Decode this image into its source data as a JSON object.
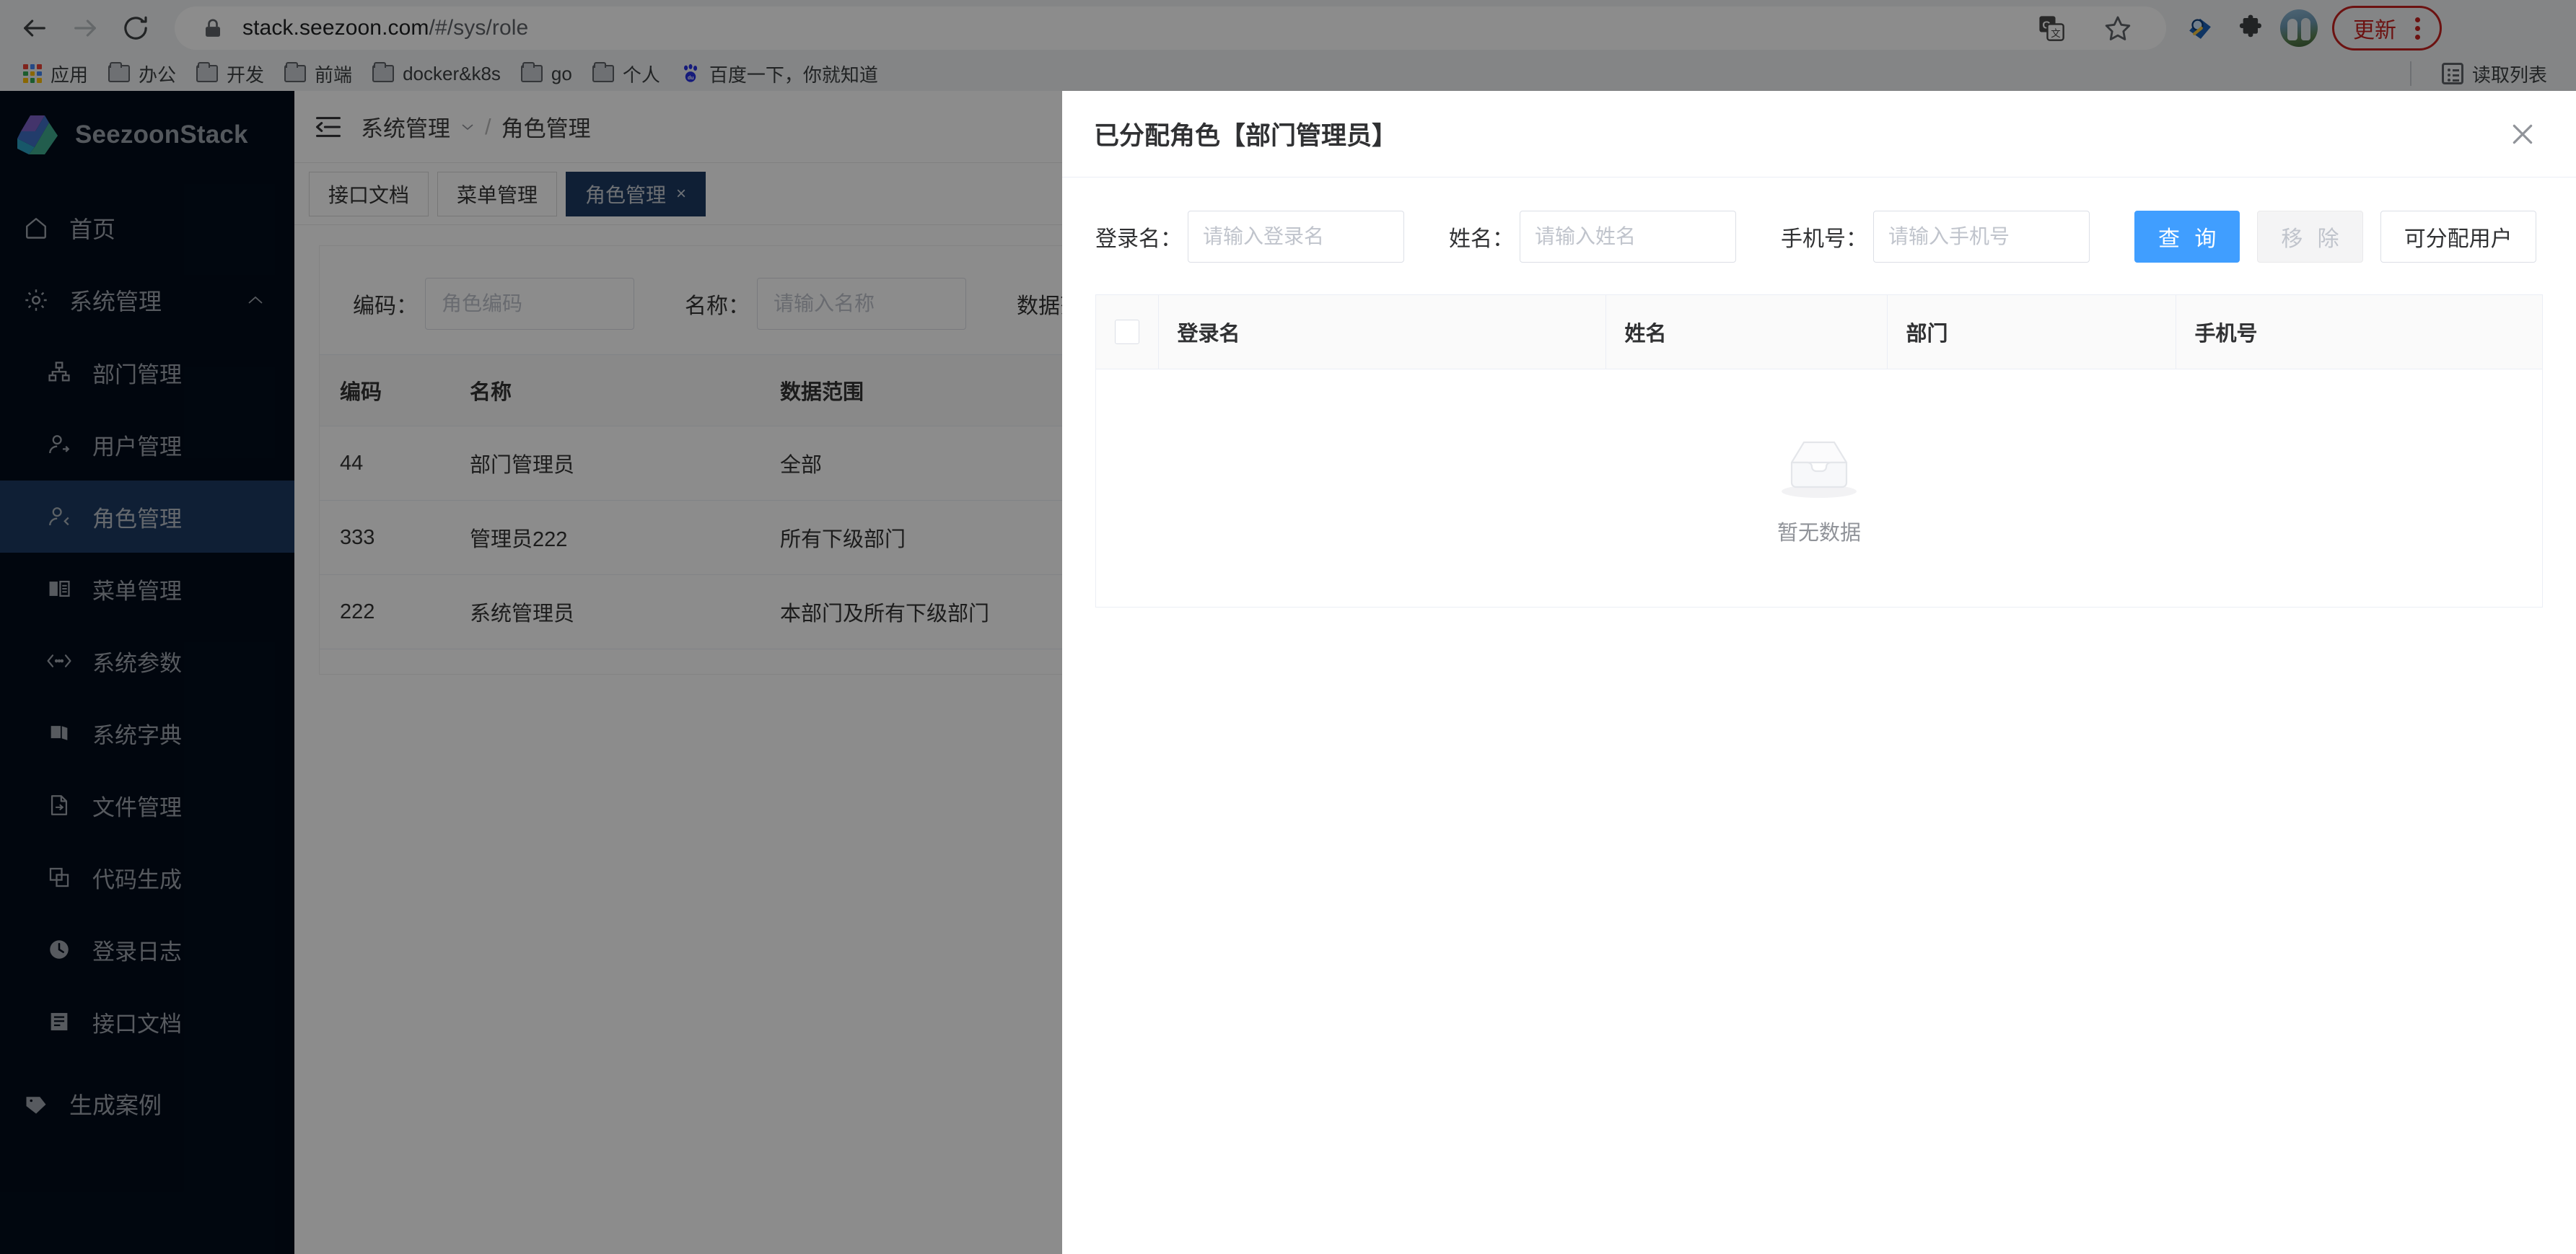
{
  "browser": {
    "url_main": "stack.seezoon.com",
    "url_path": "/#/sys/role",
    "nav": {
      "back": "back-arrow",
      "forward": "forward-arrow",
      "reload": "reload"
    },
    "actions": {
      "translate": "translate-icon",
      "bookmark_star": "star-icon",
      "extension_blue": "extension-icon",
      "extension_puzzle": "puzzle-icon",
      "profile": "avatar",
      "update_label": "更新",
      "menu": "kebab-menu"
    },
    "bookmarks": [
      {
        "label": "应用",
        "icon": "apps-grid-icon"
      },
      {
        "label": "办公",
        "icon": "folder-icon"
      },
      {
        "label": "开发",
        "icon": "folder-icon"
      },
      {
        "label": "前端",
        "icon": "folder-icon"
      },
      {
        "label": "docker&k8s",
        "icon": "folder-icon"
      },
      {
        "label": "go",
        "icon": "folder-icon"
      },
      {
        "label": "个人",
        "icon": "folder-icon"
      },
      {
        "label": "百度一下，你就知道",
        "icon": "baidu-icon"
      }
    ],
    "reading_list_label": "读取列表"
  },
  "sidebar": {
    "brand": "SeezoonStack",
    "items": [
      {
        "label": "首页",
        "icon": "home-icon",
        "level": "top"
      },
      {
        "label": "系统管理",
        "icon": "gear-icon",
        "level": "group",
        "expanded": true
      },
      {
        "label": "部门管理",
        "icon": "org-icon",
        "level": "sub"
      },
      {
        "label": "用户管理",
        "icon": "user-icon",
        "level": "sub"
      },
      {
        "label": "角色管理",
        "icon": "role-icon",
        "level": "sub",
        "active": true
      },
      {
        "label": "菜单管理",
        "icon": "book-icon",
        "level": "sub"
      },
      {
        "label": "系统参数",
        "icon": "code-icon",
        "level": "sub"
      },
      {
        "label": "系统字典",
        "icon": "books-icon",
        "level": "sub"
      },
      {
        "label": "文件管理",
        "icon": "file-icon",
        "level": "sub"
      },
      {
        "label": "代码生成",
        "icon": "copy-icon",
        "level": "sub"
      },
      {
        "label": "登录日志",
        "icon": "clock-icon",
        "level": "sub"
      },
      {
        "label": "接口文档",
        "icon": "doc-icon",
        "level": "sub"
      },
      {
        "label": "生成案例",
        "icon": "tag-icon",
        "level": "top"
      }
    ]
  },
  "breadcrumb": {
    "collapse_icon": "collapse-menu-icon",
    "root": "系统管理",
    "separator": "/",
    "current": "角色管理"
  },
  "tabs": [
    {
      "label": "接口文档",
      "active": false,
      "closable": false
    },
    {
      "label": "菜单管理",
      "active": false,
      "closable": false
    },
    {
      "label": "角色管理",
      "active": true,
      "closable": true,
      "close": "×"
    }
  ],
  "page": {
    "filters": [
      {
        "label": "编码：",
        "placeholder": "角色编码",
        "value": ""
      },
      {
        "label": "名称：",
        "placeholder": "请输入名称",
        "value": ""
      },
      {
        "label": "数据范围：",
        "placeholder": "",
        "value": ""
      }
    ],
    "table": {
      "columns": [
        "编码",
        "名称",
        "数据范围"
      ],
      "rows": [
        {
          "code": "44",
          "name": "部门管理员",
          "scope": "全部"
        },
        {
          "code": "333",
          "name": "管理员222",
          "scope": "所有下级部门"
        },
        {
          "code": "222",
          "name": "系统管理员",
          "scope": "本部门及所有下级部门"
        }
      ]
    }
  },
  "drawer": {
    "title": "已分配角色【部门管理员】",
    "close_icon": "close-icon",
    "form": {
      "fields": [
        {
          "label": "登录名：",
          "placeholder": "请输入登录名",
          "value": ""
        },
        {
          "label": "姓名：",
          "placeholder": "请输入姓名",
          "value": ""
        },
        {
          "label": "手机号：",
          "placeholder": "请输入手机号",
          "value": ""
        }
      ],
      "buttons": [
        {
          "label": "查 询",
          "type": "primary"
        },
        {
          "label": "移 除",
          "type": "disabled"
        },
        {
          "label": "可分配用户",
          "type": "default"
        }
      ]
    },
    "table": {
      "columns": [
        "登录名",
        "姓名",
        "部门",
        "手机号"
      ],
      "rows": [],
      "empty_text": "暂无数据",
      "empty_icon": "empty-box-icon"
    }
  },
  "colors": {
    "sidebar_bg": "#020c1b",
    "sidebar_active": "#1d3a62",
    "primary": "#409eff",
    "tab_active": "#1d3a62",
    "update_red": "#c5221f",
    "overlay": "rgba(0,0,0,0.45)"
  }
}
